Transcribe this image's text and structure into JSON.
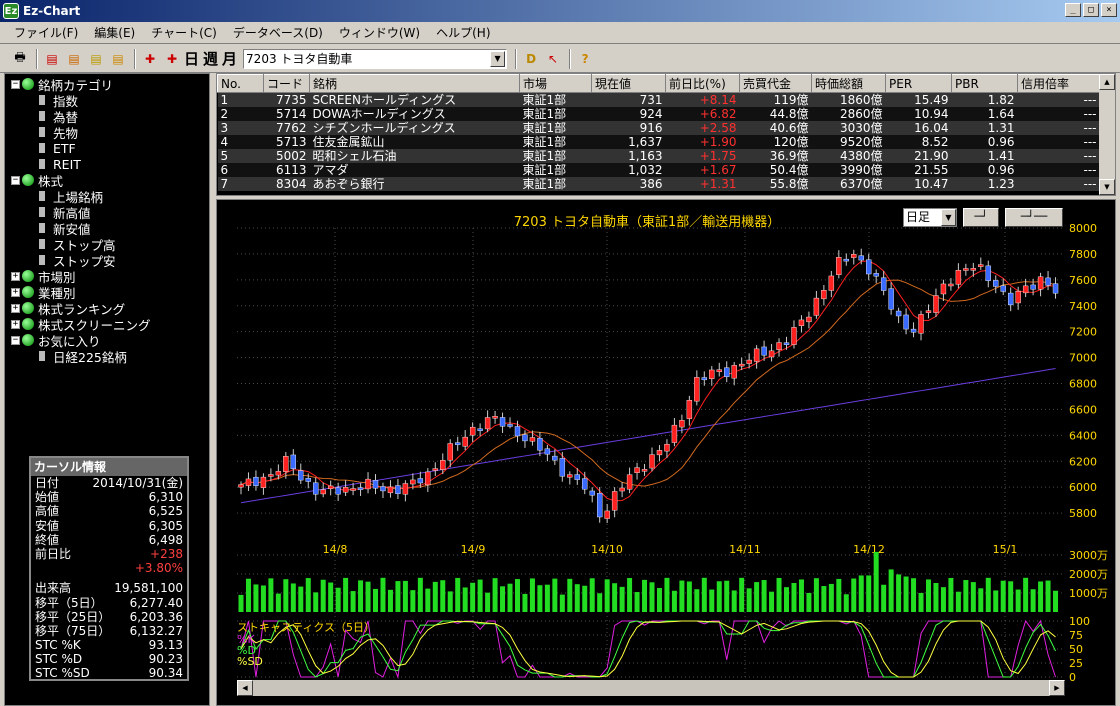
{
  "window": {
    "title": "Ez-Chart",
    "logo": "Ez"
  },
  "menu": [
    "ファイル(F)",
    "編集(E)",
    "チャート(C)",
    "データベース(D)",
    "ウィンドウ(W)",
    "ヘルプ(H)"
  ],
  "toolbar": {
    "day": "日",
    "week": "週",
    "month": "月",
    "stock_combo": "7203 トヨタ自動車"
  },
  "tree": [
    {
      "label": "銘柄カテゴリ",
      "level": 0,
      "expanded": true
    },
    {
      "label": "指数",
      "level": 1
    },
    {
      "label": "為替",
      "level": 1
    },
    {
      "label": "先物",
      "level": 1
    },
    {
      "label": "ETF",
      "level": 1
    },
    {
      "label": "REIT",
      "level": 1
    },
    {
      "label": "株式",
      "level": 0,
      "expanded": true
    },
    {
      "label": "上場銘柄",
      "level": 1
    },
    {
      "label": "新高値",
      "level": 1
    },
    {
      "label": "新安値",
      "level": 1
    },
    {
      "label": "ストップ高",
      "level": 1
    },
    {
      "label": "ストップ安",
      "level": 1
    },
    {
      "label": "市場別",
      "level": 0,
      "expanded": false
    },
    {
      "label": "業種別",
      "level": 0,
      "expanded": false
    },
    {
      "label": "株式ランキング",
      "level": 0,
      "expanded": false
    },
    {
      "label": "株式スクリーニング",
      "level": 0,
      "expanded": false
    },
    {
      "label": "お気に入り",
      "level": 0,
      "expanded": true
    },
    {
      "label": "日経225銘柄",
      "level": 1
    }
  ],
  "cursor_info": {
    "title": "カーソル情報",
    "rows": [
      {
        "k": "日付",
        "v": "2014/10/31(金)"
      },
      {
        "k": "始値",
        "v": "6,310"
      },
      {
        "k": "高値",
        "v": "6,525"
      },
      {
        "k": "安値",
        "v": "6,305"
      },
      {
        "k": "終値",
        "v": "6,498"
      },
      {
        "k": "前日比",
        "v": "+238",
        "red": true
      },
      {
        "k": "",
        "v": "+3.80%",
        "red": true
      },
      {
        "k": "出来高",
        "v": "19,581,100"
      },
      {
        "k": "移平（5日）",
        "v": "6,277.40"
      },
      {
        "k": "移平（25日）",
        "v": "6,203.36"
      },
      {
        "k": "移平（75日）",
        "v": "6,132.27"
      },
      {
        "k": "STC %K",
        "v": "93.13"
      },
      {
        "k": "STC %D",
        "v": "90.23"
      },
      {
        "k": "STC %SD",
        "v": "90.34"
      }
    ]
  },
  "table": {
    "headers": [
      "No.",
      "コード",
      "銘柄",
      "市場",
      "現在値",
      "前日比(%)",
      "売買代金",
      "時価総額",
      "PER",
      "PBR",
      "信用倍率"
    ],
    "rows": [
      [
        "1",
        "7735",
        "SCREENホールディングス",
        "東証1部",
        "731",
        "+8.14",
        "119億",
        "1860億",
        "15.49",
        "1.82",
        "---"
      ],
      [
        "2",
        "5714",
        "DOWAホールディングス",
        "東証1部",
        "924",
        "+6.82",
        "44.8億",
        "2860億",
        "10.94",
        "1.64",
        "---"
      ],
      [
        "3",
        "7762",
        "シチズンホールディングス",
        "東証1部",
        "916",
        "+2.58",
        "40.6億",
        "3030億",
        "16.04",
        "1.31",
        "---"
      ],
      [
        "4",
        "5713",
        "住友金属鉱山",
        "東証1部",
        "1,637",
        "+1.90",
        "120億",
        "9520億",
        "8.52",
        "0.96",
        "---"
      ],
      [
        "5",
        "5002",
        "昭和シェル石油",
        "東証1部",
        "1,163",
        "+1.75",
        "36.9億",
        "4380億",
        "21.90",
        "1.41",
        "---"
      ],
      [
        "6",
        "6113",
        "アマダ",
        "東証1部",
        "1,032",
        "+1.67",
        "50.4億",
        "3990億",
        "21.55",
        "0.96",
        "---"
      ],
      [
        "7",
        "8304",
        "あおぞら銀行",
        "東証1部",
        "386",
        "+1.31",
        "55.8億",
        "6370億",
        "10.47",
        "1.23",
        "---"
      ]
    ]
  },
  "chart_data": {
    "type": "candlestick",
    "title": "7203 トヨタ自動車（東証1部／輸送用機器）",
    "period": "日足",
    "x_tick_labels": [
      "14/8",
      "14/9",
      "14/10",
      "14/11",
      "14/12",
      "15/1"
    ],
    "ylim": [
      5600,
      8000
    ],
    "y_ticks": [
      5800,
      6000,
      6200,
      6400,
      6600,
      6800,
      7000,
      7200,
      7400,
      7600,
      7800,
      8000
    ],
    "price_anchors": [
      6000,
      6060,
      6100,
      6200,
      6060,
      5950,
      5980,
      6000,
      6010,
      5990,
      5990,
      6020,
      6110,
      6250,
      6350,
      6480,
      6530,
      6470,
      6400,
      6300,
      6200,
      6080,
      5990,
      5780,
      5960,
      6100,
      6220,
      6300,
      6498,
      6820,
      6870,
      6900,
      6960,
      7020,
      7080,
      7150,
      7300,
      7500,
      7700,
      7820,
      7700,
      7500,
      7300,
      7200,
      7400,
      7600,
      7650,
      7720,
      7600,
      7400,
      7550,
      7600,
      7500
    ],
    "ma_colors": {
      "ma5": "#ff2020",
      "ma25": "#d2691e",
      "ma75": "#6a3de0"
    },
    "volume": {
      "label_ticks": [
        "3000万",
        "2000万",
        "1000万"
      ],
      "ylim": [
        0,
        3000
      ]
    },
    "stochastic": {
      "title": "ストキャスティクス（5日）",
      "series": [
        "%K",
        "%D",
        "%SD"
      ],
      "colors": [
        "#e020e0",
        "#40ff40",
        "#ffff40"
      ],
      "ticks": [
        100,
        75,
        50,
        25,
        0
      ]
    }
  },
  "colors": {
    "up_candle": "#ff2020",
    "down_candle": "#3a6aff",
    "volume_bar": "#22dd22",
    "grid": "#4a4a4a",
    "label": "#ffd700"
  }
}
